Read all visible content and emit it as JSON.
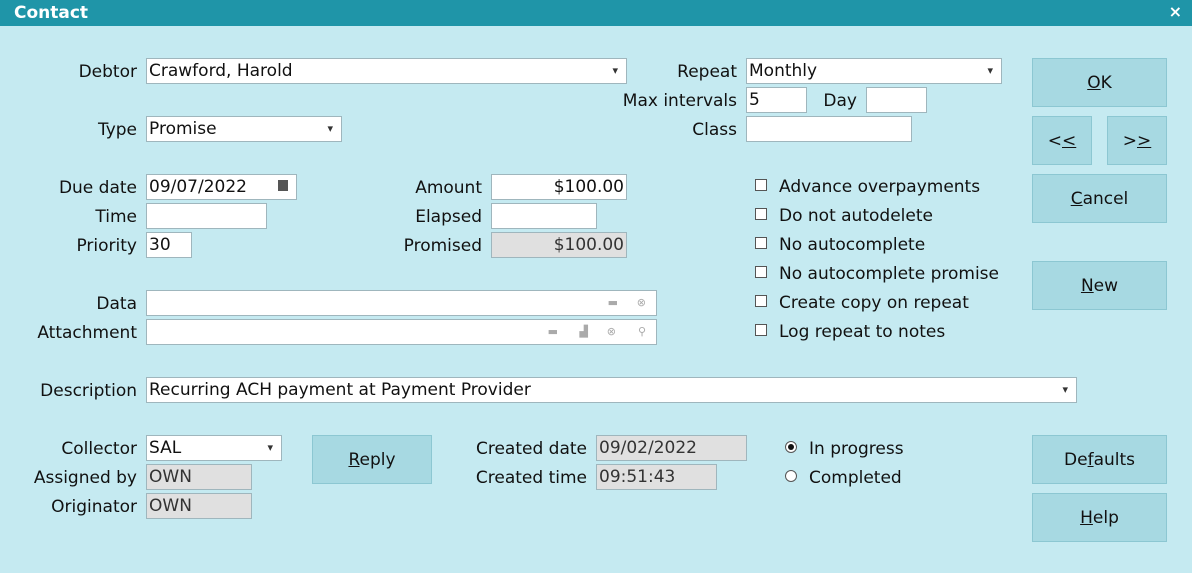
{
  "window": {
    "title": "Contact",
    "close_glyph": "×"
  },
  "fields": {
    "debtor": {
      "label": "Debtor",
      "value": "Crawford, Harold"
    },
    "type": {
      "label": "Type",
      "value": "Promise"
    },
    "repeat": {
      "label": "Repeat",
      "value": "Monthly"
    },
    "max_intervals": {
      "label": "Max intervals",
      "value": "5"
    },
    "day": {
      "label": "Day",
      "value": ""
    },
    "class": {
      "label": "Class",
      "value": ""
    },
    "due_date": {
      "label": "Due date",
      "value": "09/07/2022"
    },
    "time": {
      "label": "Time",
      "value": ""
    },
    "priority": {
      "label": "Priority",
      "value": "30"
    },
    "amount": {
      "label": "Amount",
      "value": "$100.00"
    },
    "elapsed": {
      "label": "Elapsed",
      "value": ""
    },
    "promised": {
      "label": "Promised",
      "value": "$100.00"
    },
    "data": {
      "label": "Data",
      "value": ""
    },
    "attachment": {
      "label": "Attachment",
      "value": ""
    },
    "description": {
      "label": "Description",
      "value": "Recurring ACH payment at Payment Provider"
    },
    "collector": {
      "label": "Collector",
      "value": "SAL"
    },
    "assigned_by": {
      "label": "Assigned by",
      "value": "OWN"
    },
    "originator": {
      "label": "Originator",
      "value": "OWN"
    },
    "created_date": {
      "label": "Created date",
      "value": "09/02/2022"
    },
    "created_time": {
      "label": "Created time",
      "value": "09:51:43"
    }
  },
  "checkboxes": [
    {
      "label": "Advance overpayments",
      "checked": false
    },
    {
      "label": "Do not autodelete",
      "checked": false
    },
    {
      "label": "No autocomplete",
      "checked": false
    },
    {
      "label": "No autocomplete promise",
      "checked": false
    },
    {
      "label": "Create copy on repeat",
      "checked": false
    },
    {
      "label": "Log repeat to notes",
      "checked": false
    }
  ],
  "status": {
    "options": [
      {
        "label": "In progress",
        "selected": true
      },
      {
        "label": "Completed",
        "selected": false
      }
    ]
  },
  "buttons": {
    "ok": {
      "label": "OK",
      "mnemonic": "O",
      "rest": "K"
    },
    "prev": {
      "lead": "<",
      "mnemonic": "<"
    },
    "next": {
      "lead": ">",
      "mnemonic": ">"
    },
    "cancel": {
      "mnemonic": "C",
      "rest": "ancel"
    },
    "new": {
      "mnemonic": "N",
      "rest": "ew"
    },
    "reply": {
      "mnemonic": "R",
      "rest": "eply"
    },
    "defaults": {
      "lead": "De",
      "mnemonic": "f",
      "rest": "aults"
    },
    "help": {
      "mnemonic": "H",
      "rest": "elp"
    }
  },
  "icons": {
    "dropdown": "▾",
    "folder": "▬",
    "clear": "⊗",
    "print": "▟",
    "search": "⚲"
  },
  "colors": {
    "titlebar": "#1f95a8",
    "background": "#c5eaf1",
    "button": "#a7d9e2"
  }
}
